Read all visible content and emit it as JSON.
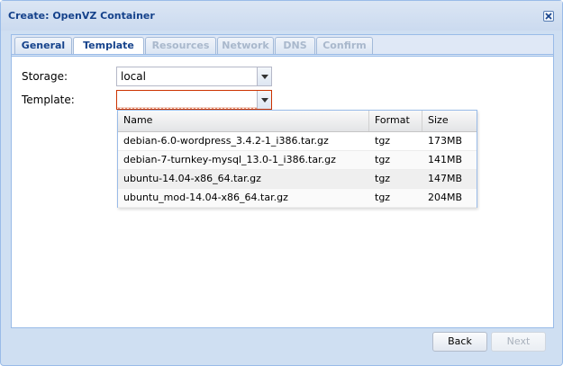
{
  "window": {
    "title": "Create: OpenVZ Container",
    "colors": {
      "title": "#15428b",
      "border": "#99bbe8",
      "invalid": "#cc3300"
    }
  },
  "tabs": [
    {
      "label": "General",
      "state": "normal"
    },
    {
      "label": "Template",
      "state": "active"
    },
    {
      "label": "Resources",
      "state": "disabled"
    },
    {
      "label": "Network",
      "state": "disabled"
    },
    {
      "label": "DNS",
      "state": "disabled"
    },
    {
      "label": "Confirm",
      "state": "disabled"
    }
  ],
  "form": {
    "storage_label": "Storage:",
    "storage_value": "local",
    "template_label": "Template:",
    "template_value": ""
  },
  "template_picker": {
    "columns": [
      "Name",
      "Format",
      "Size"
    ],
    "rows": [
      {
        "name": "debian-6.0-wordpress_3.4.2-1_i386.tar.gz",
        "format": "tgz",
        "size": "173MB"
      },
      {
        "name": "debian-7-turnkey-mysql_13.0-1_i386.tar.gz",
        "format": "tgz",
        "size": "141MB"
      },
      {
        "name": "ubuntu-14.04-x86_64.tar.gz",
        "format": "tgz",
        "size": "147MB"
      },
      {
        "name": "ubuntu_mod-14.04-x86_64.tar.gz",
        "format": "tgz",
        "size": "204MB"
      }
    ],
    "hovered_row": 2
  },
  "footer": {
    "back_label": "Back",
    "next_label": "Next"
  },
  "icons": {
    "close": "close-icon",
    "dropdown": "chevron-down-icon"
  }
}
